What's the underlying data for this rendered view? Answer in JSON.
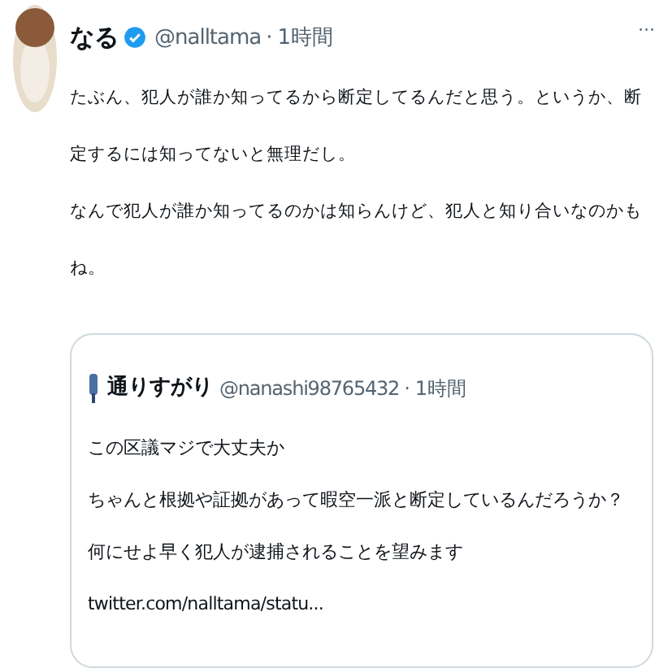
{
  "tweet": {
    "author_name": "なる",
    "verified": true,
    "handle": "@nalltama",
    "separator": "·",
    "time": "1時間",
    "more": "···",
    "paragraphs": [
      "たぶん、犯人が誰か知ってるから断定してるんだと思う。というか、断定するには知ってないと無理だし。",
      "なんで犯人が誰か知ってるのかは知らんけど、犯人と知り合いなのかもね。"
    ],
    "quoted_tweet": {
      "author_name": "通りすがり",
      "handle": "@nanashi98765432",
      "separator": "·",
      "time": "1時間",
      "lines": [
        "この区議マジで大丈夫か",
        "ちゃんと根拠や証拠があって暇空一派と断定しているんだろうか？",
        "何にせよ早く犯人が逮捕されることを望みます"
      ],
      "link": "twitter.com/nalltama/statu..."
    }
  }
}
